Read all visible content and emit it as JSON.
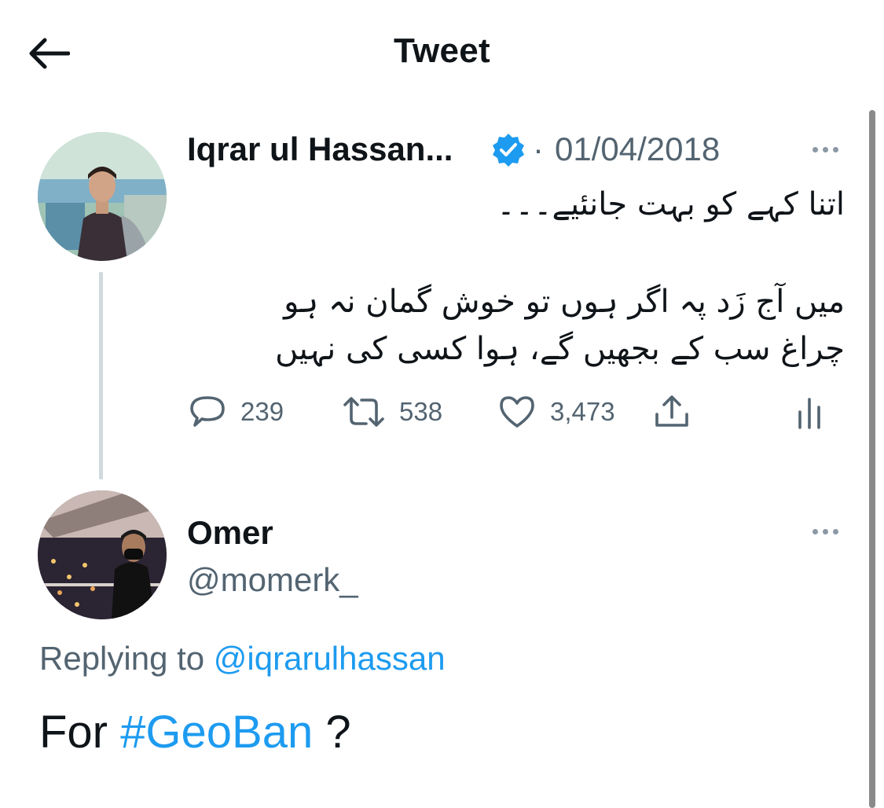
{
  "header": {
    "title": "Tweet",
    "back_icon": "arrow-left-icon"
  },
  "original_tweet": {
    "author_name": "Iqrar ul Hassan...",
    "verified": true,
    "separator": "·",
    "date": "01/04/2018",
    "text_lines": [
      "اتنا کہے کو بہت جانئیے۔۔۔",
      "میں آج زَد پہ اگر ہوں تو خوش گمان نہ ہو",
      "چراغ سب کے بجھیں گے، ہوا کسی کی نہیں"
    ],
    "stats": {
      "replies": "239",
      "retweets": "538",
      "likes": "3,473"
    }
  },
  "reply_tweet": {
    "author_name": "Omer",
    "handle": "@momerk_",
    "replying_prefix": "Replying to",
    "replying_to": "@iqrarulhassan",
    "text_prefix": "For",
    "hashtag": "#GeoBan",
    "text_suffix": "?"
  },
  "colors": {
    "accent": "#1d9bf0",
    "secondary_text": "#536471",
    "primary_text": "#0f1419",
    "thread_line": "#cfd9de"
  }
}
